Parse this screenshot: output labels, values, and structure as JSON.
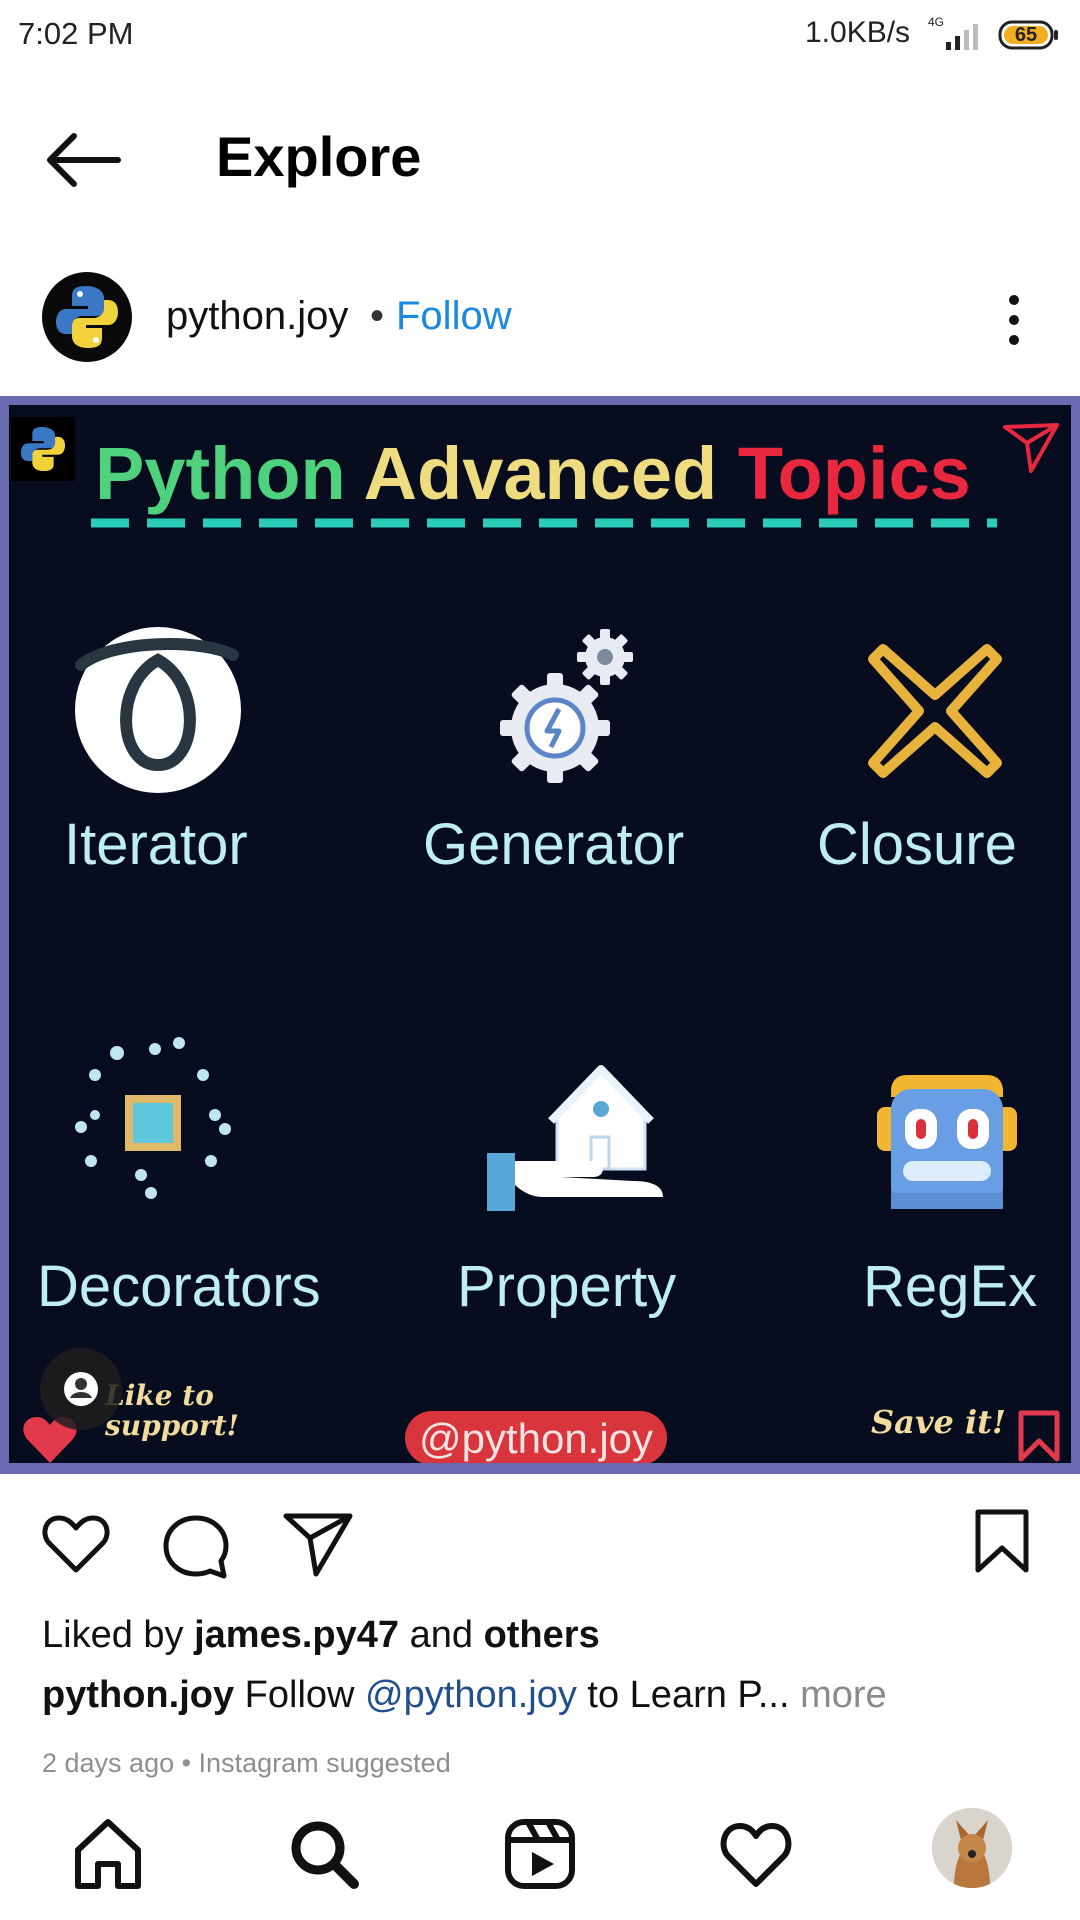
{
  "status_bar": {
    "time": "7:02 PM",
    "net_speed": "1.0KB/s",
    "net_type": "4G",
    "battery": "65"
  },
  "header": {
    "back_icon": "arrow-left-icon",
    "title": "Explore"
  },
  "post": {
    "username": "python.joy",
    "separator": "•",
    "follow_label": "Follow",
    "avatar_label": "@python.joy",
    "image": {
      "title_words": [
        "Python",
        "Advanced",
        "Topics"
      ],
      "title_colors": [
        "#4fd27d",
        "#f0dc80",
        "#e7283e"
      ],
      "topics": [
        "Iterator",
        "Generator",
        "Closure",
        "Decorators",
        "Property",
        "RegEx"
      ],
      "like_support_line1": "Like to",
      "like_support_line2": "support!",
      "handle": "@python.joy",
      "save_label": "Save it!"
    },
    "actions": [
      "heart-icon",
      "comment-icon",
      "share-icon",
      "bookmark-icon"
    ],
    "liked_by_prefix": "Liked by",
    "liked_by_user": "james.py47",
    "liked_by_and": "and",
    "liked_by_others": "others",
    "caption_user": "python.joy",
    "caption_text_1": "Follow",
    "caption_mention": "@python.joy",
    "caption_text_2": "to Learn P...",
    "caption_more": "more",
    "timestamp": "2 days ago • Instagram suggested"
  },
  "bottom_nav": [
    "home-icon",
    "search-icon",
    "reels-icon",
    "activity-heart-icon",
    "profile-avatar"
  ]
}
